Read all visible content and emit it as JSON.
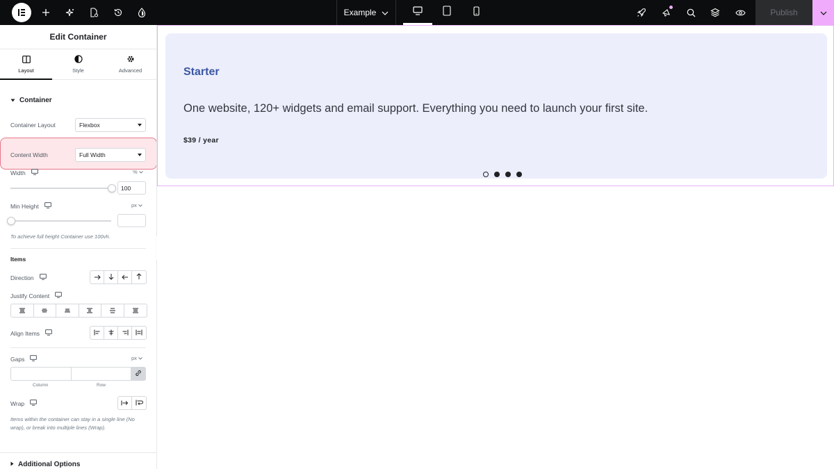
{
  "topbar": {
    "site_name": "Example",
    "publish_label": "Publish",
    "icons": [
      "elementor-logo",
      "add-icon",
      "ai-sparkle-icon",
      "page-settings-icon",
      "history-icon",
      "site-settings-icon",
      "desktop-icon",
      "tablet-icon",
      "mobile-icon",
      "rocket-icon",
      "notifications-icon",
      "search-icon",
      "structure-icon",
      "preview-icon",
      "chevron-down-icon"
    ]
  },
  "panel": {
    "title": "Edit Container",
    "tabs": [
      {
        "label": "Layout"
      },
      {
        "label": "Style"
      },
      {
        "label": "Advanced"
      }
    ],
    "container_section": "Container",
    "container_layout": {
      "label": "Container Layout",
      "value": "Flexbox"
    },
    "content_width": {
      "label": "Content Width",
      "value": "Full Width"
    },
    "width": {
      "label": "Width",
      "unit": "%",
      "value": "100",
      "fraction": 1.0
    },
    "min_height": {
      "label": "Min Height",
      "unit": "px",
      "value": "",
      "fraction": 0.0,
      "hint": "To achieve full height Container use 100vh."
    },
    "items_heading": "Items",
    "direction": {
      "label": "Direction"
    },
    "justify_content": {
      "label": "Justify Content"
    },
    "align_items": {
      "label": "Align Items"
    },
    "gaps": {
      "label": "Gaps",
      "unit": "px",
      "column_label": "Column",
      "row_label": "Row"
    },
    "wrap": {
      "label": "Wrap",
      "hint": "Items within the container can stay in a single line (No wrap), or break into multiple lines (Wrap)."
    },
    "additional_options": "Additional Options"
  },
  "canvas": {
    "card_title": "Starter",
    "card_text": "One website, 120+ widgets and email support. Everything you need to launch your first site.",
    "card_price": "$39 / year",
    "carousel_active_index": 0,
    "carousel_count": 4
  },
  "colors": {
    "topbar_bg": "#0c0d0e",
    "accent_pink": "#f0abfc",
    "card_bg": "#eceefc",
    "card_title": "#3b57a0",
    "highlight_border": "#e6778a"
  }
}
